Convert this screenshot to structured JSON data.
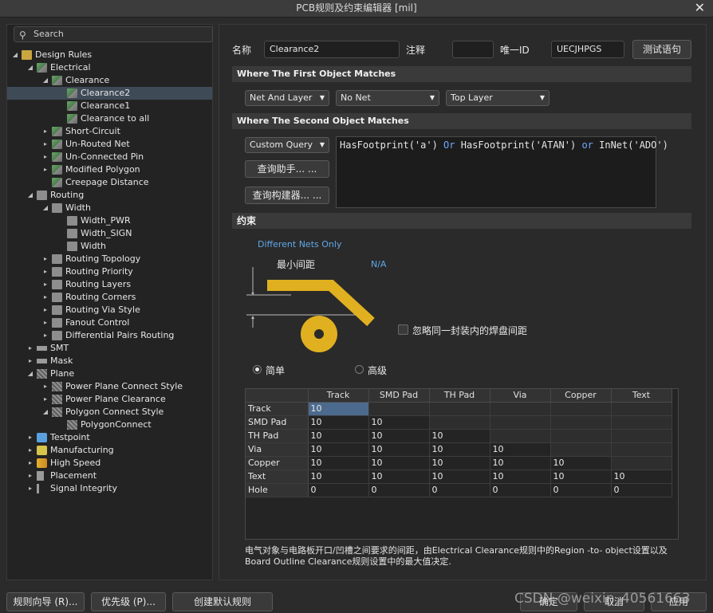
{
  "window": {
    "title": "PCB规则及约束编辑器 [mil]",
    "close_glyph": "✕"
  },
  "search": {
    "placeholder": "Search"
  },
  "tree": [
    {
      "label": "Design Rules",
      "level": 0,
      "expander": "◢",
      "icon": "folder"
    },
    {
      "label": "Electrical",
      "level": 1,
      "expander": "◢",
      "icon": "rule"
    },
    {
      "label": "Clearance",
      "level": 2,
      "expander": "◢",
      "icon": "rule"
    },
    {
      "label": "Clearance2",
      "level": 3,
      "expander": "",
      "icon": "rule",
      "selected": true
    },
    {
      "label": "Clearance1",
      "level": 3,
      "expander": "",
      "icon": "rule"
    },
    {
      "label": "Clearance to all",
      "level": 3,
      "expander": "",
      "icon": "rule"
    },
    {
      "label": "Short-Circuit",
      "level": 2,
      "expander": "▸",
      "icon": "rule"
    },
    {
      "label": "Un-Routed Net",
      "level": 2,
      "expander": "▸",
      "icon": "rule"
    },
    {
      "label": "Un-Connected Pin",
      "level": 2,
      "expander": "▸",
      "icon": "rule"
    },
    {
      "label": "Modified Polygon",
      "level": 2,
      "expander": "▸",
      "icon": "rule"
    },
    {
      "label": "Creepage Distance",
      "level": 2,
      "expander": "",
      "icon": "rule"
    },
    {
      "label": "Routing",
      "level": 1,
      "expander": "◢",
      "icon": "rule2"
    },
    {
      "label": "Width",
      "level": 2,
      "expander": "◢",
      "icon": "rule2"
    },
    {
      "label": "Width_PWR",
      "level": 3,
      "expander": "",
      "icon": "rule2"
    },
    {
      "label": "Width_SIGN",
      "level": 3,
      "expander": "",
      "icon": "rule2"
    },
    {
      "label": "Width",
      "level": 3,
      "expander": "",
      "icon": "rule2"
    },
    {
      "label": "Routing Topology",
      "level": 2,
      "expander": "▸",
      "icon": "rule2"
    },
    {
      "label": "Routing Priority",
      "level": 2,
      "expander": "▸",
      "icon": "rule2"
    },
    {
      "label": "Routing Layers",
      "level": 2,
      "expander": "▸",
      "icon": "rule2"
    },
    {
      "label": "Routing Corners",
      "level": 2,
      "expander": "▸",
      "icon": "rule2"
    },
    {
      "label": "Routing Via Style",
      "level": 2,
      "expander": "▸",
      "icon": "rule2"
    },
    {
      "label": "Fanout Control",
      "level": 2,
      "expander": "▸",
      "icon": "rule2"
    },
    {
      "label": "Differential Pairs Routing",
      "level": 2,
      "expander": "▸",
      "icon": "rule2"
    },
    {
      "label": "SMT",
      "level": 1,
      "expander": "▸",
      "icon": "bar"
    },
    {
      "label": "Mask",
      "level": 1,
      "expander": "▸",
      "icon": "bar"
    },
    {
      "label": "Plane",
      "level": 1,
      "expander": "◢",
      "icon": "chk"
    },
    {
      "label": "Power Plane Connect Style",
      "level": 2,
      "expander": "▸",
      "icon": "chk"
    },
    {
      "label": "Power Plane Clearance",
      "level": 2,
      "expander": "▸",
      "icon": "chk"
    },
    {
      "label": "Polygon Connect Style",
      "level": 2,
      "expander": "◢",
      "icon": "chk"
    },
    {
      "label": "PolygonConnect",
      "level": 3,
      "expander": "",
      "icon": "chk"
    },
    {
      "label": "Testpoint",
      "level": 1,
      "expander": "▸",
      "icon": "tp"
    },
    {
      "label": "Manufacturing",
      "level": 1,
      "expander": "▸",
      "icon": "mf"
    },
    {
      "label": "High Speed",
      "level": 1,
      "expander": "▸",
      "icon": "hs"
    },
    {
      "label": "Placement",
      "level": 1,
      "expander": "▸",
      "icon": "pl"
    },
    {
      "label": "Signal Integrity",
      "level": 1,
      "expander": "▸",
      "icon": "si"
    }
  ],
  "rule": {
    "name_label": "名称",
    "name_value": "Clearance2",
    "comment_label": "注释",
    "comment_value": "",
    "uid_label": "唯一ID",
    "uid_value": "UECJHPGS",
    "test_button": "测试语句"
  },
  "first_match": {
    "header": "Where The First Object Matches",
    "dropdowns": [
      "Net And Layer",
      "No Net",
      "Top Layer"
    ]
  },
  "second_match": {
    "header": "Where The Second Object Matches",
    "dropdown": "Custom Query",
    "query_helper_button": "查询助手... ...",
    "query_builder_button": "查询构建器... ...",
    "query": {
      "p1": "HasFootprint('a') ",
      "k1": "Or",
      "p2": " HasFootprint('ATAN') ",
      "k2": "or",
      "p3": " InNet('ADO')"
    }
  },
  "constraints": {
    "header": "约束",
    "different_nets": "Different Nets Only",
    "min_clearance_label": "最小间距",
    "min_clearance_value": "N/A",
    "ignore_pad_label": "忽略同一封装内的焊盘间距",
    "simple_label": "简单",
    "advanced_label": "高级",
    "mode": "simple",
    "trace_color": "#e0b020"
  },
  "matrix": {
    "columns": [
      "Track",
      "SMD Pad",
      "TH Pad",
      "Via",
      "Copper",
      "Text"
    ],
    "rows": [
      {
        "name": "Track",
        "values": [
          "10"
        ]
      },
      {
        "name": "SMD Pad",
        "values": [
          "10",
          "10"
        ]
      },
      {
        "name": "TH Pad",
        "values": [
          "10",
          "10",
          "10"
        ]
      },
      {
        "name": "Via",
        "values": [
          "10",
          "10",
          "10",
          "10"
        ]
      },
      {
        "name": "Copper",
        "values": [
          "10",
          "10",
          "10",
          "10",
          "10"
        ]
      },
      {
        "name": "Text",
        "values": [
          "10",
          "10",
          "10",
          "10",
          "10",
          "10"
        ]
      },
      {
        "name": "Hole",
        "values": [
          "0",
          "0",
          "0",
          "0",
          "0",
          "0"
        ]
      }
    ]
  },
  "footnote": "电气对象与电路板开口/凹槽之间要求的间距，由Electrical Clearance规则中的Region -to- object设置以及Board Outline Clearance规则设置中的最大值决定.",
  "bottom": {
    "rule_wizard": "规则向导 (R)...",
    "priority": "优先级 (P)...",
    "create_default": "创建默认规则",
    "ok": "确定",
    "cancel": "取消",
    "apply": "应用"
  },
  "watermark": "CSDN @weixin_40561663"
}
